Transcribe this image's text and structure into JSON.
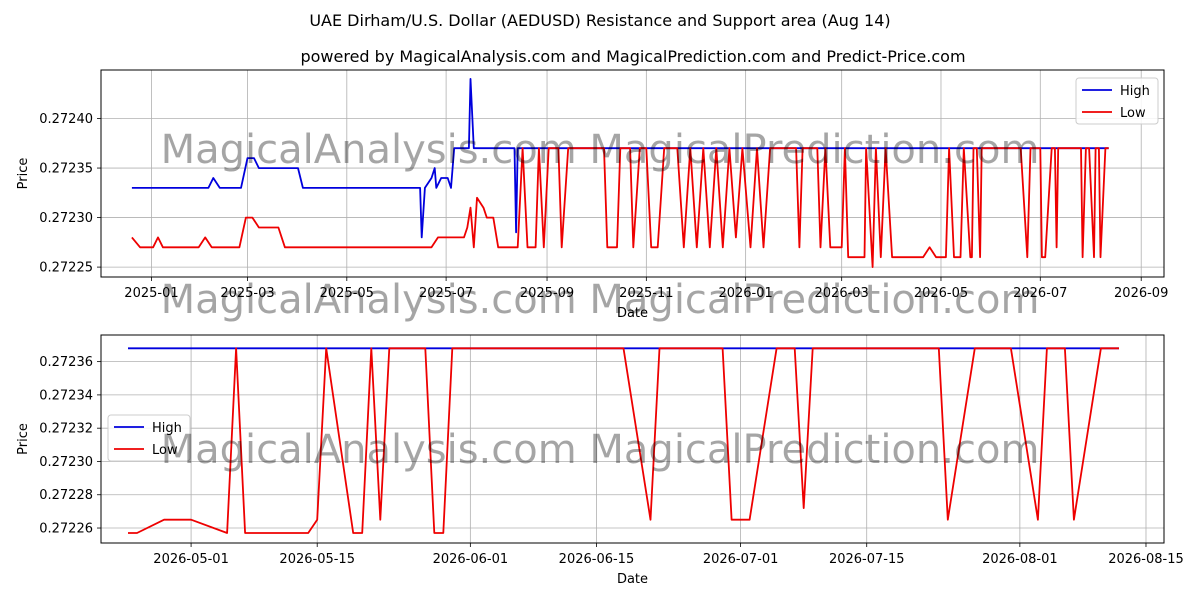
{
  "title": "UAE Dirham/U.S. Dollar (AEDUSD) Resistance and Support area (Aug 14)",
  "subtitle": "powered by MagicalAnalysis.com and MagicalPrediction.com and Predict-Price.com",
  "watermark": "MagicalAnalysis.com   MagicalPrediction.com",
  "colors": {
    "high": "#0000dd",
    "low": "#ee0000",
    "grid": "#b0b0b0"
  },
  "chart_data": [
    {
      "type": "line",
      "xlabel": "Date",
      "ylabel": "Price",
      "grid": true,
      "legend": "top-right",
      "x_ticks": [
        "2025-01",
        "2025-03",
        "2025-05",
        "2025-07",
        "2025-09",
        "2025-11",
        "2026-01",
        "2026-03",
        "2026-05",
        "2026-07",
        "2026-09"
      ],
      "y_ticks": [
        "0.27225",
        "0.27230",
        "0.27235",
        "0.27240"
      ],
      "xlim": [
        "2024-12-01",
        "2026-09-15"
      ],
      "ylim": [
        0.27224,
        0.272449
      ],
      "series": [
        {
          "name": "High",
          "color": "#0000dd",
          "points": [
            [
              "2024-12-20",
              0.27233
            ],
            [
              "2025-02-05",
              0.27233
            ],
            [
              "2025-02-08",
              0.27234
            ],
            [
              "2025-02-12",
              0.27233
            ],
            [
              "2025-02-25",
              0.27233
            ],
            [
              "2025-03-01",
              0.27236
            ],
            [
              "2025-03-05",
              0.27236
            ],
            [
              "2025-03-08",
              0.27235
            ],
            [
              "2025-04-01",
              0.27235
            ],
            [
              "2025-04-04",
              0.27233
            ],
            [
              "2025-06-15",
              0.27233
            ],
            [
              "2025-06-16",
              0.27228
            ],
            [
              "2025-06-18",
              0.27233
            ],
            [
              "2025-06-22",
              0.27234
            ],
            [
              "2025-06-24",
              0.27235
            ],
            [
              "2025-06-25",
              0.27233
            ],
            [
              "2025-06-28",
              0.27234
            ],
            [
              "2025-07-02",
              0.27234
            ],
            [
              "2025-07-04",
              0.27233
            ],
            [
              "2025-07-06",
              0.27237
            ],
            [
              "2025-07-13",
              0.27237
            ],
            [
              "2025-07-15",
              0.27237
            ],
            [
              "2025-07-16",
              0.27244
            ],
            [
              "2025-07-18",
              0.27237
            ],
            [
              "2025-08-12",
              0.27237
            ],
            [
              "2025-08-13",
              0.272285
            ],
            [
              "2025-08-14",
              0.27237
            ],
            [
              "2026-08-12",
              0.27237
            ]
          ]
        },
        {
          "name": "Low",
          "color": "#ee0000",
          "points": [
            [
              "2024-12-20",
              0.27228
            ],
            [
              "2024-12-25",
              0.27227
            ],
            [
              "2025-01-02",
              0.27227
            ],
            [
              "2025-01-05",
              0.27228
            ],
            [
              "2025-01-08",
              0.27227
            ],
            [
              "2025-01-12",
              0.27227
            ],
            [
              "2025-01-15",
              0.27227
            ],
            [
              "2025-01-18",
              0.27227
            ],
            [
              "2025-01-22",
              0.27227
            ],
            [
              "2025-01-26",
              0.27227
            ],
            [
              "2025-01-30",
              0.27227
            ],
            [
              "2025-02-03",
              0.27228
            ],
            [
              "2025-02-07",
              0.27227
            ],
            [
              "2025-02-12",
              0.27227
            ],
            [
              "2025-02-16",
              0.27227
            ],
            [
              "2025-02-20",
              0.27227
            ],
            [
              "2025-02-24",
              0.27227
            ],
            [
              "2025-02-28",
              0.2723
            ],
            [
              "2025-03-04",
              0.2723
            ],
            [
              "2025-03-08",
              0.27229
            ],
            [
              "2025-03-14",
              0.27229
            ],
            [
              "2025-03-20",
              0.27229
            ],
            [
              "2025-03-24",
              0.27227
            ],
            [
              "2025-04-01",
              0.27227
            ],
            [
              "2025-04-10",
              0.27227
            ],
            [
              "2025-04-20",
              0.27227
            ],
            [
              "2025-05-01",
              0.27227
            ],
            [
              "2025-05-10",
              0.27227
            ],
            [
              "2025-05-20",
              0.27227
            ],
            [
              "2025-06-01",
              0.27227
            ],
            [
              "2025-06-10",
              0.27227
            ],
            [
              "2025-06-16",
              0.27227
            ],
            [
              "2025-06-22",
              0.27227
            ],
            [
              "2025-06-26",
              0.27228
            ],
            [
              "2025-07-02",
              0.27228
            ],
            [
              "2025-07-06",
              0.27228
            ],
            [
              "2025-07-10",
              0.27228
            ],
            [
              "2025-07-12",
              0.27228
            ],
            [
              "2025-07-14",
              0.27229
            ],
            [
              "2025-07-16",
              0.27231
            ],
            [
              "2025-07-18",
              0.27227
            ],
            [
              "2025-07-20",
              0.27232
            ],
            [
              "2025-07-24",
              0.27231
            ],
            [
              "2025-07-26",
              0.2723
            ],
            [
              "2025-07-30",
              0.2723
            ],
            [
              "2025-08-02",
              0.27227
            ],
            [
              "2025-08-05",
              0.27227
            ],
            [
              "2025-08-10",
              0.27227
            ],
            [
              "2025-08-14",
              0.27227
            ],
            [
              "2025-08-17",
              0.27237
            ],
            [
              "2025-08-20",
              0.27227
            ],
            [
              "2025-08-25",
              0.27227
            ],
            [
              "2025-08-27",
              0.27237
            ],
            [
              "2025-08-30",
              0.27227
            ],
            [
              "2025-09-02",
              0.27237
            ],
            [
              "2025-09-08",
              0.27237
            ],
            [
              "2025-09-10",
              0.27227
            ],
            [
              "2025-09-14",
              0.27237
            ],
            [
              "2025-10-06",
              0.27237
            ],
            [
              "2025-10-08",
              0.27227
            ],
            [
              "2025-10-14",
              0.27227
            ],
            [
              "2025-10-16",
              0.27237
            ],
            [
              "2025-10-22",
              0.27237
            ],
            [
              "2025-10-24",
              0.27227
            ],
            [
              "2025-10-28",
              0.27237
            ],
            [
              "2025-11-01",
              0.27237
            ],
            [
              "2025-11-04",
              0.27227
            ],
            [
              "2025-11-08",
              0.27227
            ],
            [
              "2025-11-12",
              0.27237
            ],
            [
              "2025-11-20",
              0.27237
            ],
            [
              "2025-11-24",
              0.27227
            ],
            [
              "2025-11-28",
              0.27237
            ],
            [
              "2025-12-02",
              0.27227
            ],
            [
              "2025-12-06",
              0.27237
            ],
            [
              "2025-12-10",
              0.27227
            ],
            [
              "2025-12-14",
              0.27237
            ],
            [
              "2025-12-18",
              0.27227
            ],
            [
              "2025-12-22",
              0.27237
            ],
            [
              "2025-12-26",
              0.27228
            ],
            [
              "2025-12-30",
              0.27237
            ],
            [
              "2026-01-04",
              0.27227
            ],
            [
              "2026-01-08",
              0.27237
            ],
            [
              "2026-01-12",
              0.27227
            ],
            [
              "2026-01-16",
              0.27237
            ],
            [
              "2026-02-01",
              0.27237
            ],
            [
              "2026-02-03",
              0.27227
            ],
            [
              "2026-02-05",
              0.27237
            ],
            [
              "2026-02-14",
              0.27237
            ],
            [
              "2026-02-16",
              0.27227
            ],
            [
              "2026-02-19",
              0.27237
            ],
            [
              "2026-02-22",
              0.27227
            ],
            [
              "2026-03-01",
              0.27227
            ],
            [
              "2026-03-03",
              0.27237
            ],
            [
              "2026-03-05",
              0.27226
            ],
            [
              "2026-03-15",
              0.27226
            ],
            [
              "2026-03-16",
              0.27237
            ],
            [
              "2026-03-20",
              0.27225
            ],
            [
              "2026-03-22",
              0.27237
            ],
            [
              "2026-03-25",
              0.27226
            ],
            [
              "2026-03-28",
              0.27237
            ],
            [
              "2026-04-01",
              0.27226
            ],
            [
              "2026-04-20",
              0.27226
            ],
            [
              "2026-04-24",
              0.27227
            ],
            [
              "2026-04-28",
              0.27226
            ],
            [
              "2026-05-04",
              0.27226
            ],
            [
              "2026-05-06",
              0.27237
            ],
            [
              "2026-05-09",
              0.27226
            ],
            [
              "2026-05-13",
              0.27226
            ],
            [
              "2026-05-15",
              0.27237
            ],
            [
              "2026-05-19",
              0.27226
            ],
            [
              "2026-05-20",
              0.27226
            ],
            [
              "2026-05-21",
              0.27237
            ],
            [
              "2026-05-23",
              0.27237
            ],
            [
              "2026-05-25",
              0.27226
            ],
            [
              "2026-05-26",
              0.27237
            ],
            [
              "2026-06-19",
              0.27237
            ],
            [
              "2026-06-23",
              0.27226
            ],
            [
              "2026-06-25",
              0.27237
            ],
            [
              "2026-07-01",
              0.27237
            ],
            [
              "2026-07-02",
              0.27226
            ],
            [
              "2026-07-04",
              0.27226
            ],
            [
              "2026-07-08",
              0.27237
            ],
            [
              "2026-07-10",
              0.27237
            ],
            [
              "2026-07-11",
              0.27227
            ],
            [
              "2026-07-12",
              0.27237
            ],
            [
              "2026-07-26",
              0.27237
            ],
            [
              "2026-07-27",
              0.27226
            ],
            [
              "2026-07-29",
              0.27237
            ],
            [
              "2026-07-31",
              0.27237
            ],
            [
              "2026-08-03",
              0.27226
            ],
            [
              "2026-08-04",
              0.27237
            ],
            [
              "2026-08-06",
              0.27237
            ],
            [
              "2026-08-07",
              0.27226
            ],
            [
              "2026-08-10",
              0.27237
            ],
            [
              "2026-08-12",
              0.27237
            ]
          ]
        }
      ]
    },
    {
      "type": "line",
      "xlabel": "Date",
      "ylabel": "Price",
      "grid": true,
      "legend": "center-left",
      "x_ticks": [
        "2026-05-01",
        "2026-05-15",
        "2026-06-01",
        "2026-06-15",
        "2026-07-01",
        "2026-07-15",
        "2026-08-01",
        "2026-08-15"
      ],
      "y_ticks": [
        "0.27226",
        "0.27228",
        "0.27230",
        "0.27232",
        "0.27234",
        "0.27236"
      ],
      "xlim": [
        "2026-04-21",
        "2026-08-17"
      ],
      "ylim": [
        0.272251,
        0.272376
      ],
      "series": [
        {
          "name": "High",
          "color": "#0000dd",
          "points": [
            [
              "2026-04-24",
              0.272368
            ],
            [
              "2026-08-12",
              0.272368
            ]
          ]
        },
        {
          "name": "Low",
          "color": "#ee0000",
          "points": [
            [
              "2026-04-24",
              0.272257
            ],
            [
              "2026-04-25",
              0.272257
            ],
            [
              "2026-04-28",
              0.272265
            ],
            [
              "2026-04-30",
              0.272265
            ],
            [
              "2026-05-01",
              0.272265
            ],
            [
              "2026-05-05",
              0.272257
            ],
            [
              "2026-05-06",
              0.272368
            ],
            [
              "2026-05-07",
              0.272257
            ],
            [
              "2026-05-14",
              0.272257
            ],
            [
              "2026-05-15",
              0.272265
            ],
            [
              "2026-05-16",
              0.272368
            ],
            [
              "2026-05-19",
              0.272257
            ],
            [
              "2026-05-20",
              0.272257
            ],
            [
              "2026-05-21",
              0.272368
            ],
            [
              "2026-05-22",
              0.272265
            ],
            [
              "2026-05-23",
              0.272368
            ],
            [
              "2026-05-27",
              0.272368
            ],
            [
              "2026-05-28",
              0.272257
            ],
            [
              "2026-05-29",
              0.272257
            ],
            [
              "2026-05-30",
              0.272368
            ],
            [
              "2026-06-18",
              0.272368
            ],
            [
              "2026-06-21",
              0.272265
            ],
            [
              "2026-06-22",
              0.272368
            ],
            [
              "2026-06-29",
              0.272368
            ],
            [
              "2026-06-30",
              0.272265
            ],
            [
              "2026-07-02",
              0.272265
            ],
            [
              "2026-07-05",
              0.272368
            ],
            [
              "2026-07-07",
              0.272368
            ],
            [
              "2026-07-08",
              0.272272
            ],
            [
              "2026-07-09",
              0.272368
            ],
            [
              "2026-07-23",
              0.272368
            ],
            [
              "2026-07-24",
              0.272265
            ],
            [
              "2026-07-27",
              0.272368
            ],
            [
              "2026-07-31",
              0.272368
            ],
            [
              "2026-08-03",
              0.272265
            ],
            [
              "2026-08-04",
              0.272368
            ],
            [
              "2026-08-06",
              0.272368
            ],
            [
              "2026-08-07",
              0.272265
            ],
            [
              "2026-08-10",
              0.272368
            ],
            [
              "2026-08-12",
              0.272368
            ]
          ]
        }
      ]
    }
  ]
}
